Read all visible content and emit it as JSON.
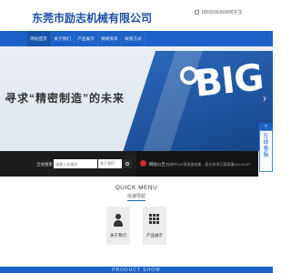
{
  "header": {
    "company_name": "东莞市励志机械有限公司",
    "phone": "18565963668何先生"
  },
  "nav": {
    "items": [
      {
        "label": "网站首页"
      },
      {
        "label": "关于我们"
      },
      {
        "label": "产品展示"
      },
      {
        "label": "微闻资讯"
      },
      {
        "label": "联系方式"
      }
    ]
  },
  "banner": {
    "logo_text": "BIG",
    "slogan": "寻求“精密制造”的未来"
  },
  "search": {
    "label": "全站搜索：",
    "placeholder": "请输入关键词",
    "select_value": "关于我们"
  },
  "news": {
    "label": "网站公告：",
    "headline": "抢修中心5项改造成果，部分技术已获国家...",
    "date": "2024-03-07"
  },
  "side_tab": {
    "close": "×",
    "chars": [
      "在",
      "线",
      "客",
      "服"
    ]
  },
  "quick_menu": {
    "title": "QUICK MENU",
    "subtitle": "快速导航",
    "cards": [
      {
        "label": "关于我们",
        "icon": "person-icon"
      },
      {
        "label": "产品展示",
        "icon": "grid-icon"
      }
    ]
  },
  "footer": {
    "text": "PRODUCT SHOW"
  },
  "colors": {
    "brand_blue": "#1c62c6",
    "dark_bar": "#1c1c1c"
  }
}
